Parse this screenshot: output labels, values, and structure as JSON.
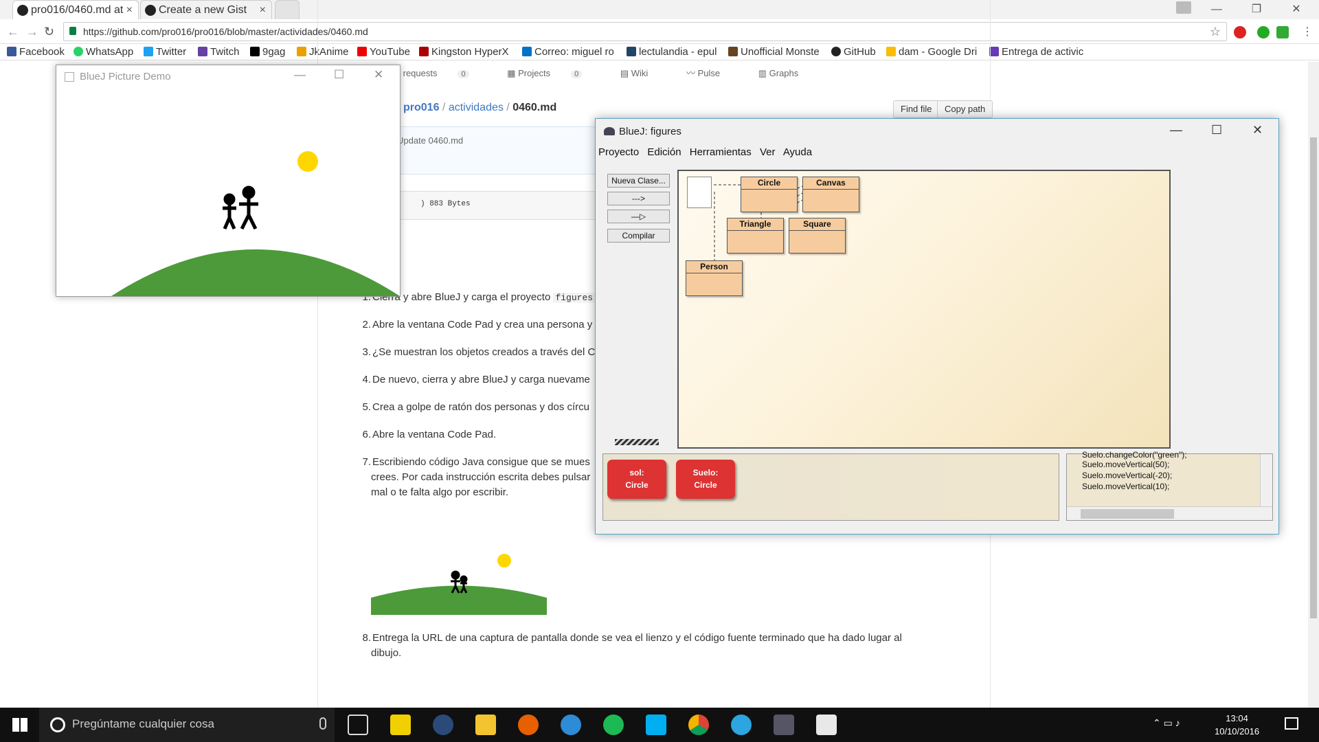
{
  "browser": {
    "tabs": [
      {
        "label": "pro016/0460.md at"
      },
      {
        "label": "Create a new Gist"
      }
    ],
    "url": "https://github.com/pro016/pro016/blob/master/actividades/0460.md",
    "bookmarks": [
      "Facebook",
      "WhatsApp",
      "Twitter",
      "Twitch",
      "9gag",
      "JkAnime",
      "YouTube",
      "Kingston HyperX",
      "Correo: miguel ro",
      "lectulandia - epul",
      "Unofficial Monste",
      "GitHub",
      "dam - Google Dri",
      "Entrega de activic"
    ]
  },
  "github": {
    "nav": [
      "ull requests",
      "Projects",
      "Wiki",
      "Pulse",
      "Graphs"
    ],
    "pull_count": "0",
    "projects_count": "0",
    "breadcrumb_repo": "pro016",
    "breadcrumb_sep1": " / ",
    "breadcrumb_dir": "actividades",
    "breadcrumb_sep2": " / ",
    "breadcrumb_file": "0460.md",
    "find_file": "Find file",
    "copy_path": "Copy path",
    "commit_msg": "Update 0460.md",
    "file_info": ")   883 Bytes",
    "steps": [
      {
        "n": "1.",
        "text": "Cierra y abre BlueJ y carga el proyecto ",
        "code": "figures"
      },
      {
        "n": "2.",
        "text": "Abre la ventana Code Pad y crea una persona y"
      },
      {
        "n": "3.",
        "text": "¿Se muestran los objetos creados a través del C"
      },
      {
        "n": "4.",
        "text": "De nuevo, cierra y abre BlueJ y carga nuevame"
      },
      {
        "n": "5.",
        "text": "Crea a golpe de ratón dos personas y dos círcu"
      },
      {
        "n": "6.",
        "text": "Abre la ventana Code Pad."
      },
      {
        "n": "7.",
        "text": "Escribiendo código Java consigue que se mues",
        "cont1": "crees. Por cada instrucción escrita debes pulsar",
        "cont2": "mal o te falta algo por escribir."
      },
      {
        "n": "8.",
        "text": "Entrega la URL de una captura de pantalla donde se vea el lienzo y el código fuente terminado que ha dado lugar al",
        "cont1": "dibujo."
      }
    ]
  },
  "picture_demo": {
    "title": "BlueJ Picture Demo"
  },
  "bluej": {
    "title": "BlueJ:  figures",
    "menu": [
      "Proyecto",
      "Edición",
      "Herramientas",
      "Ver",
      "Ayuda"
    ],
    "buttons": {
      "new_class": "Nueva Clase...",
      "dep_arrow": "--->",
      "inh_arrow": "—▷",
      "compile": "Compilar"
    },
    "classes": [
      "Circle",
      "Canvas",
      "Triangle",
      "Square",
      "Person"
    ],
    "objects": [
      {
        "name": "sol:",
        "type": "Circle"
      },
      {
        "name": "Suelo:",
        "type": "Circle"
      }
    ],
    "codepad_lines": [
      "Suelo.changeColor(\"green\");",
      "Suelo.moveVertical(50);",
      "Suelo.moveVertical(-20);",
      "Suelo.moveVertical(10);"
    ]
  },
  "taskbar": {
    "search_placeholder": "Pregúntame cualquier cosa",
    "time": "13:04",
    "date": "10/10/2016"
  }
}
